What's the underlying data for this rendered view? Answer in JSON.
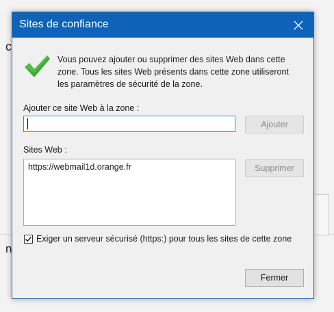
{
  "background": {
    "fragment_top": "ca",
    "fragment_bottom": "n"
  },
  "dialog": {
    "title": "Sites de confiance",
    "info_text": "Vous pouvez ajouter ou supprimer des sites Web dans cette\nzone. Tous les sites Web présents dans cette zone utiliseront\nles paramètres de sécurité de la zone.",
    "add_label": "Ajouter ce site Web à la zone :",
    "add_input_value": "",
    "add_button": "Ajouter",
    "sites_label": "Sites Web :",
    "sites": [
      "https://webmail1d.orange.fr"
    ],
    "remove_button": "Supprimer",
    "https_checkbox_label": "Exiger un serveur sécurisé (https:) pour tous les sites de cette zone",
    "https_checked": true,
    "close_button": "Fermer"
  },
  "colors": {
    "title_bar": "#0e63b8",
    "check_green": "#3faa36"
  },
  "icons": {
    "check": "green-checkmark-icon",
    "close": "close-x-icon",
    "checkbox_check": "checkmark-icon"
  }
}
